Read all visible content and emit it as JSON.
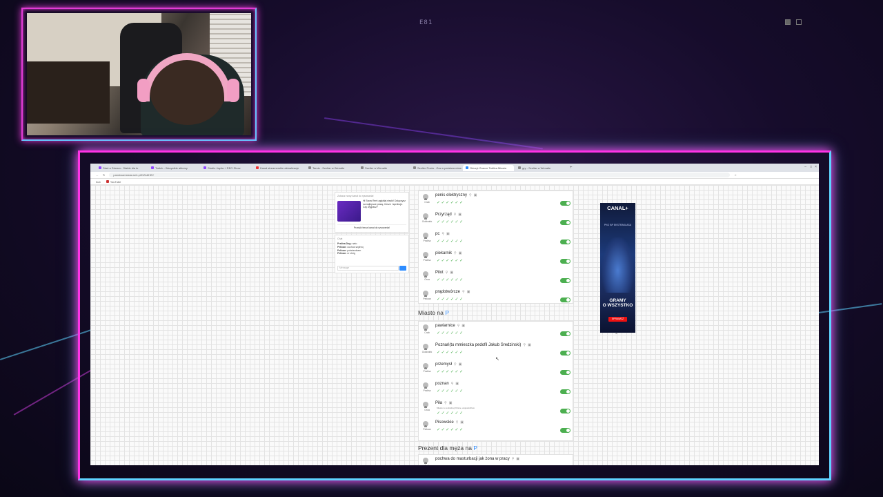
{
  "overlay": {
    "code": "E81"
  },
  "browser": {
    "tabs": [
      {
        "label": "Start a Stream - Stable dia kr",
        "color": "#9146ff"
      },
      {
        "label": "Twitch - Wszystkie aktorzy",
        "color": "#9146ff"
      },
      {
        "label": "Studio Jayda + REO Show",
        "color": "#9146ff"
      },
      {
        "label": "Kanał streamerskie aktualizacje",
        "color": "#e33"
      },
      {
        "label": "Tarnis - Szeltar w Wenaite",
        "color": "#888"
      },
      {
        "label": "Szelter w Wenaite",
        "color": "#888"
      },
      {
        "label": "Szelter Pusta - Gra w państwa miasta",
        "color": "#888"
      },
      {
        "label": "Odczyt Gracze Tablica Miasta",
        "color": "#2d8cff"
      },
      {
        "label": "gry - Szeltar w Wenaite",
        "color": "#888"
      }
    ],
    "url": "panstwamiasta.web.pl/DZA8HBY",
    "bookmarks": [
      "hub",
      "YouTube"
    ]
  },
  "promo": {
    "title": "Zobacz nowy kanał do rysowania!",
    "text": "Hi Snow Rent zgłębiaj niszki! Dołączysz na najlepsze pracę, fresze i spróbuje. Czy wygrasz?",
    "button": "Przejdź teraz kanał do rysowania!"
  },
  "chat": {
    "title": "Chat",
    "messages": [
      {
        "user": "Pralina Dog:",
        "text": "nato"
      },
      {
        "user": "Pelican:",
        "text": "cuchus szylrnq"
      },
      {
        "user": "Pelican:",
        "text": "potwierdzam"
      },
      {
        "user": "Pelican:",
        "text": "er cheg"
      }
    ],
    "input_placeholder": "Message"
  },
  "answers_top": [
    {
      "who": "Crab",
      "answer": "penis elektryczny",
      "note": ""
    },
    {
      "who": "Goldwink",
      "answer": "Przyrząd",
      "note": ""
    },
    {
      "who": "Pralina",
      "answer": "pc",
      "note": ""
    },
    {
      "who": "Pralina",
      "answer": "piekarnik",
      "note": ""
    },
    {
      "who": "Orca",
      "answer": "Pilot",
      "note": ""
    },
    {
      "who": "Pelican",
      "answer": "prądotwórcze",
      "note": ""
    }
  ],
  "category2": {
    "prefix": "Miasto na ",
    "letter": "P"
  },
  "answers_city": [
    {
      "who": "Crab",
      "answer": "pawiarnice",
      "note": ""
    },
    {
      "who": "Goldwink",
      "answer": "Poznań(tu mmieszka pedofil Jakub Sredzinski)",
      "note": ""
    },
    {
      "who": "Pralina",
      "answer": "przemysł",
      "note": ""
    },
    {
      "who": "Pralina",
      "answer": "poznan",
      "note": ""
    },
    {
      "who": "Orca",
      "answer": "Piła",
      "note": "Miasto w centralnej Polsce, województwo"
    },
    {
      "who": "Pelican",
      "answer": "Pisowskie",
      "note": ""
    }
  ],
  "category3": {
    "prefix": "Prezent dla męża na ",
    "letter": "P"
  },
  "answers_gift": [
    {
      "who": "Crab",
      "answer": "pochwa do masturbacji jak żona w pracy",
      "note": ""
    }
  ],
  "ad": {
    "brand": "CANAL+",
    "league": "PKO BP EKSTRAKLASA",
    "tagline_1": "GRAMY",
    "tagline_2": "O WSZYSTKO",
    "cta": "SPRAWDŹ"
  },
  "colors": {
    "accent_pink": "#ff33e6",
    "accent_cyan": "#5fd3ff",
    "check_green": "#4caf50",
    "link_blue": "#2d8cff"
  }
}
